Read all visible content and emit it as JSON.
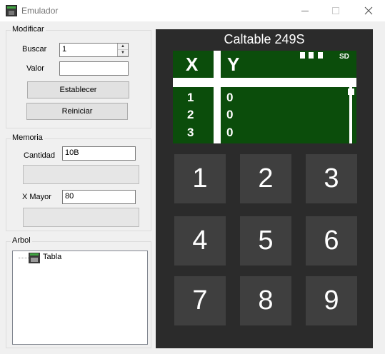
{
  "window": {
    "title": "Emulador"
  },
  "modificar": {
    "group_label": "Modificar",
    "buscar_label": "Buscar",
    "buscar_value": "1",
    "valor_label": "Valor",
    "valor_value": "",
    "establecer_label": "Establecer",
    "reiniciar_label": "Reiniciar"
  },
  "memoria": {
    "group_label": "Memoria",
    "cantidad_label": "Cantidad",
    "cantidad_value": "10B",
    "xmayor_label": "X Mayor",
    "xmayor_value": "80"
  },
  "arbol": {
    "group_label": "Arbol",
    "node_label": "Tabla"
  },
  "calculator": {
    "title": "Caltable 249S",
    "screen": {
      "col_x": "X",
      "col_y": "Y",
      "mode": "SD",
      "rows": [
        {
          "x": "1",
          "y": "0"
        },
        {
          "x": "2",
          "y": "0"
        },
        {
          "x": "3",
          "y": "0"
        }
      ]
    },
    "keys": [
      "1",
      "2",
      "3",
      "4",
      "5",
      "6",
      "7",
      "8",
      "9"
    ]
  }
}
